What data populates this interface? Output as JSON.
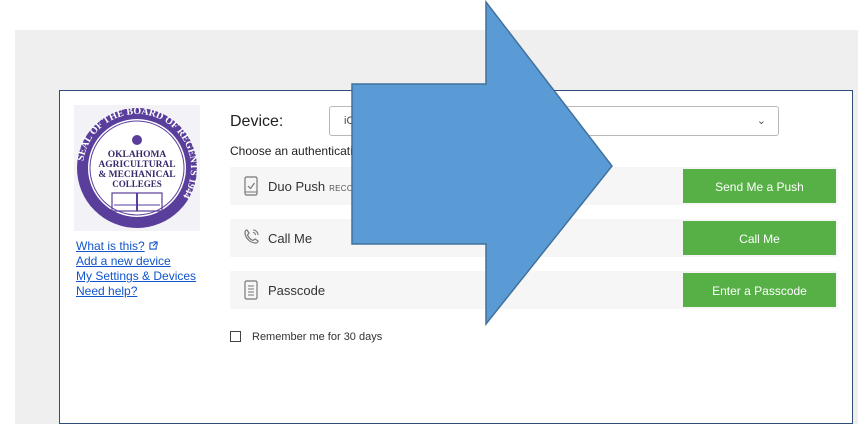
{
  "seal": {
    "ring_text": "SEAL OF THE BOARD OF REGENTS 1944",
    "line1": "OKLAHOMA",
    "line2": "AGRICULTURAL",
    "line3": "& MECHANICAL",
    "line4": "COLLEGES",
    "ring_color": "#5a3e9b"
  },
  "sidebar": {
    "links": [
      {
        "label": "What is this?"
      },
      {
        "label": "Add a new device"
      },
      {
        "label": "My Settings & Devices"
      },
      {
        "label": "Need help?"
      }
    ]
  },
  "device": {
    "label": "Device:",
    "selected": "iOS ("
  },
  "auth": {
    "choose_text": "Choose an authenticatio",
    "methods": [
      {
        "label": "Duo Push",
        "tag": "RECOMM",
        "button": "Send Me a Push",
        "icon": "phone-check-icon"
      },
      {
        "label": "Call Me",
        "button": "Call Me",
        "icon": "phone-call-icon"
      },
      {
        "label": "Passcode",
        "button": "Enter a Passcode",
        "icon": "passcode-icon"
      }
    ]
  },
  "remember": {
    "label": "Remember me for 30 days",
    "checked": false
  },
  "colors": {
    "button_green": "#57b046",
    "arrow_blue": "#5b9bd5",
    "arrow_border": "#41719c",
    "frame_border": "#2e4d7b",
    "link_blue": "#1155cc"
  }
}
